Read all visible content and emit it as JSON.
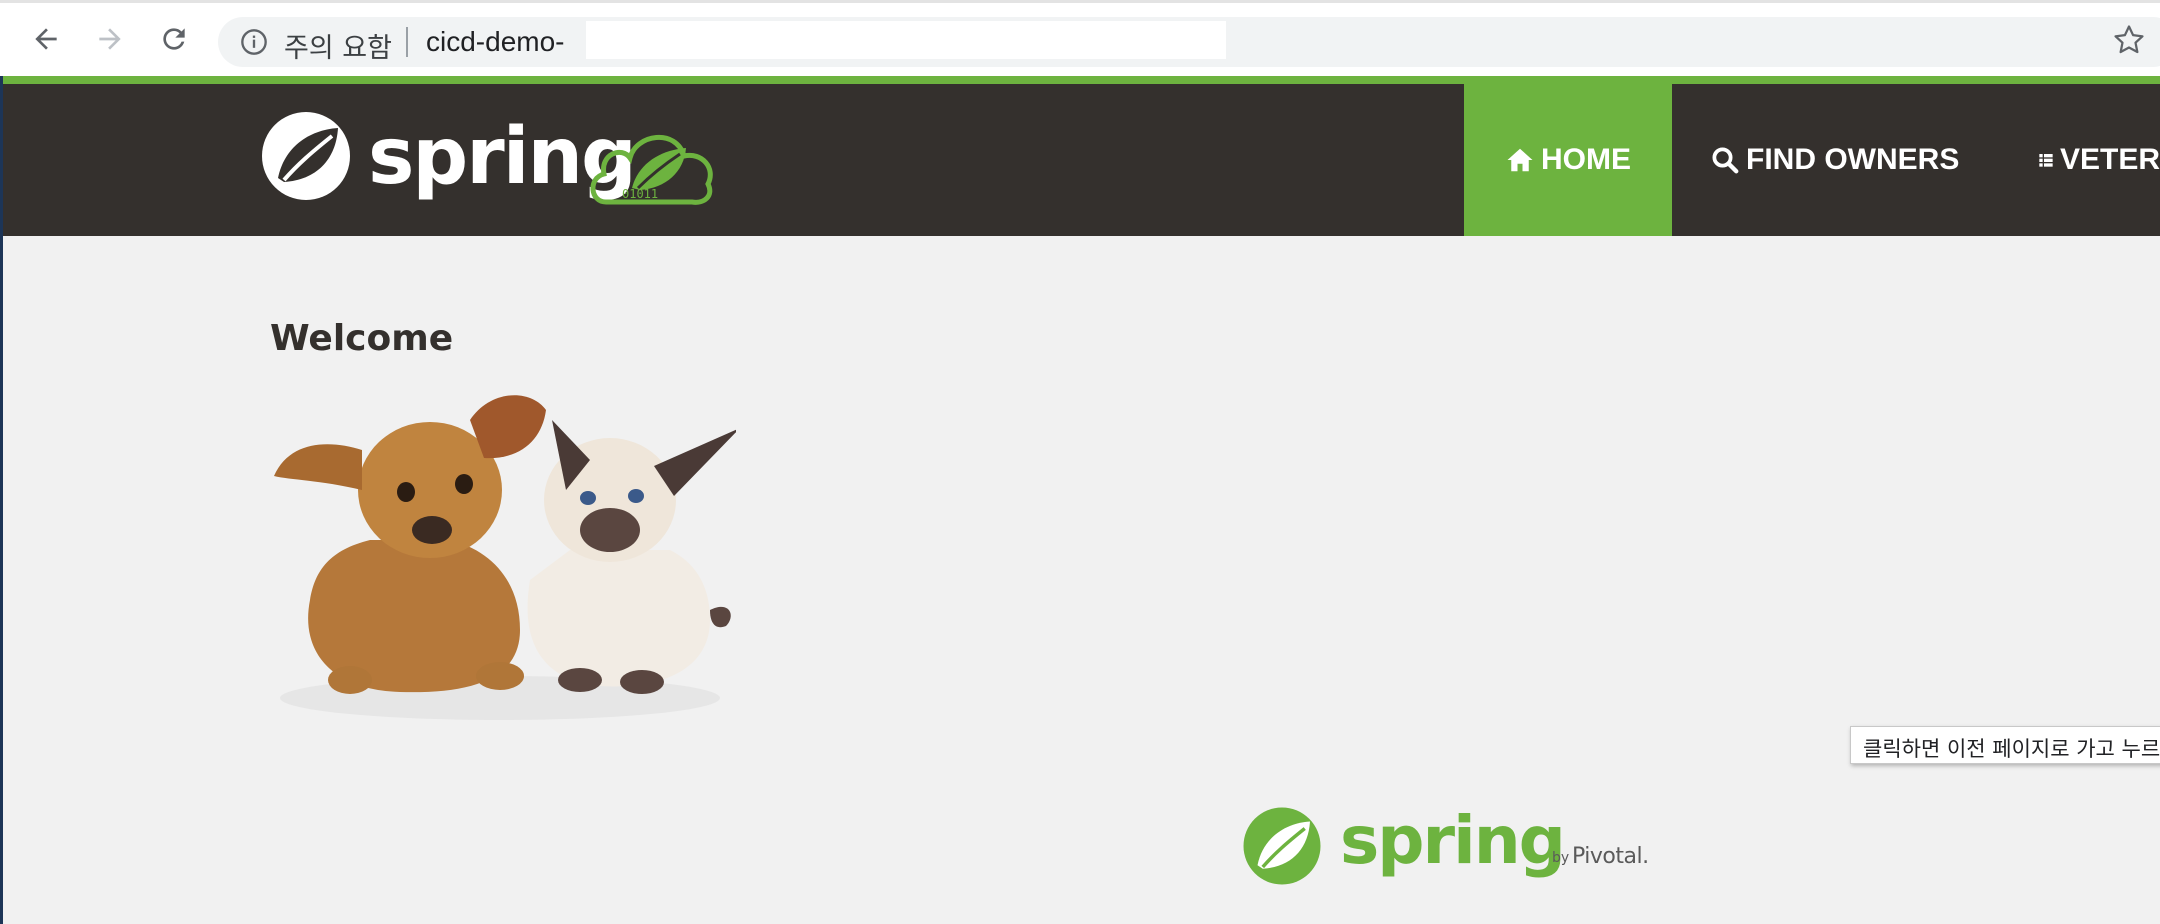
{
  "browser": {
    "security_label": "주의 요함",
    "url": "cicd-demo-",
    "icons": [
      "back-arrow-icon",
      "forward-arrow-icon",
      "reload-icon",
      "info-icon",
      "star-icon"
    ]
  },
  "navbar": {
    "brand": "spring",
    "items": [
      {
        "label": "HOME",
        "icon": "home-icon",
        "active": true
      },
      {
        "label": "FIND OWNERS",
        "icon": "search-icon",
        "active": false
      },
      {
        "label": "VETER",
        "icon": "list-icon",
        "active": false
      }
    ]
  },
  "main": {
    "title": "Welcome",
    "image": "pets-image"
  },
  "tooltip": {
    "text": "클릭하면 이전 페이지로 가고 누르고"
  },
  "footer": {
    "brand": "spring",
    "by": "by",
    "company": "Pivotal."
  },
  "colors": {
    "accent": "#6db33f",
    "header_bg": "#34302d",
    "page_bg": "#f1f1f1",
    "title": "#34302d"
  }
}
